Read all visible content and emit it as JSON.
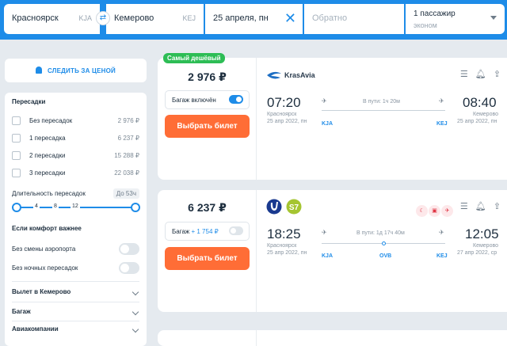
{
  "search": {
    "from_city": "Красноярск",
    "from_code": "KJA",
    "to_city": "Кемерово",
    "to_code": "KEJ",
    "date": "25 апреля, пн",
    "return_placeholder": "Обратно",
    "passengers": "1 пассажир",
    "cabin": "эконом",
    "swap_icon": "⇄",
    "clear_icon": "✕"
  },
  "sidebar": {
    "track_price": "СЛЕДИТЬ ЗА ЦЕНОЙ",
    "transfers_title": "Пересадки",
    "transfers": [
      {
        "label": "Без пересадок",
        "price": "2 976 ₽"
      },
      {
        "label": "1 пересадка",
        "price": "6 237 ₽"
      },
      {
        "label": "2 пересадки",
        "price": "15 288 ₽"
      },
      {
        "label": "3 пересадки",
        "price": "22 038 ₽"
      }
    ],
    "duration_title": "Длительность пересадок",
    "duration_badge": "До 53ч",
    "duration_ticks": [
      "4",
      "8",
      "12"
    ],
    "comfort_title": "Если комфорт важнее",
    "comfort_options": [
      "Без смены аэропорта",
      "Без ночных пересадок"
    ],
    "accordions": [
      "Вылет в Кемерово",
      "Багаж",
      "Авиакомпании"
    ]
  },
  "tickets": [
    {
      "badge": "Самый дешёвый",
      "price": "2 976 ₽",
      "baggage_label": "Багаж включён",
      "buy_label": "Выбрать билет",
      "airline": "KrasAvia",
      "dep_time": "07:20",
      "dep_city": "Красноярск",
      "dep_date": "25 апр 2022, пн",
      "dep_code": "KJA",
      "arr_time": "08:40",
      "arr_city": "Кемерово",
      "arr_date": "25 апр 2022, пн",
      "arr_code": "KEJ",
      "duration": "В пути: 1ч 20м"
    },
    {
      "price": "6 237 ₽",
      "baggage_label": "Багаж",
      "baggage_extra": "+ 1 754 ₽",
      "buy_label": "Выбрать билет",
      "dep_time": "18:25",
      "dep_city": "Красноярск",
      "dep_date": "25 апр 2022, пн",
      "dep_code": "KJA",
      "arr_time": "12:05",
      "arr_city": "Кемерово",
      "arr_date": "27 апр 2022, ср",
      "arr_code": "KEJ",
      "stop_code": "OVB",
      "duration": "В пути: 1д 17ч 40м"
    }
  ],
  "colors": {
    "accent": "#1e8ce8",
    "buy": "#ff6d36",
    "cheapest": "#2dbd55"
  }
}
